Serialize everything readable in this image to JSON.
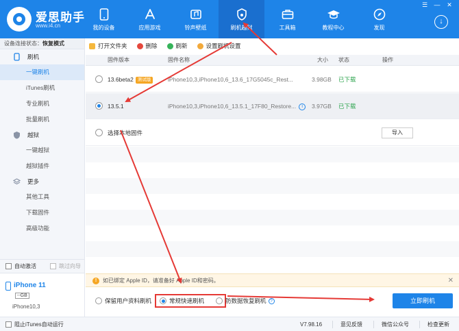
{
  "header": {
    "brand": "爱思助手",
    "url": "www.i4.cn",
    "nav": [
      {
        "label": "我的设备",
        "icon": "phone-icon"
      },
      {
        "label": "应用游戏",
        "icon": "app-store-icon"
      },
      {
        "label": "铃声壁纸",
        "icon": "ringtone-wallpaper-icon"
      },
      {
        "label": "刷机越狱",
        "icon": "shield-flash-icon",
        "active": true
      },
      {
        "label": "工具箱",
        "icon": "toolbox-icon"
      },
      {
        "label": "教程中心",
        "icon": "graduation-cap-icon"
      },
      {
        "label": "发现",
        "icon": "compass-icon"
      }
    ],
    "window": [
      "☰",
      "—",
      "✕"
    ],
    "accent": "#1e84e8"
  },
  "sidebar": {
    "status_label": "设备连接状态：",
    "status_value": "恢复模式",
    "groups": [
      {
        "label": "刷机",
        "icon": "flash-phone-icon",
        "items": [
          "一键刷机",
          "iTunes刷机",
          "专业刷机",
          "批量刷机"
        ]
      },
      {
        "label": "越狱",
        "icon": "jailbreak-icon",
        "items": [
          "一键越狱",
          "越狱插件"
        ]
      },
      {
        "label": "更多",
        "icon": "more-icon",
        "items": [
          "其他工具",
          "下载固件",
          "高级功能"
        ]
      }
    ],
    "active_item": "一键刷机",
    "auto_activate": "自动激活",
    "skip_guide": "跳过向导",
    "device": {
      "name": "iPhone 11",
      "capacity": "--GB",
      "model": "iPhone10,3"
    }
  },
  "toolbar": {
    "open_folder": "打开文件夹",
    "delete": "删除",
    "refresh": "刷新",
    "settings": "设置刷机设置"
  },
  "table": {
    "headers": [
      "固件版本",
      "固件名称",
      "大小",
      "状态",
      "操作"
    ],
    "rows": [
      {
        "version": "13.6beta2",
        "badge": "测试版",
        "name": "iPhone10,3,iPhone10,6_13.6_17G5045c_Rest...",
        "size": "3.98GB",
        "status": "已下载",
        "selected": false
      },
      {
        "version": "13.5.1",
        "name": "iPhone10,3,iPhone10,6_13.5.1_17F80_Restore...",
        "size": "3.97GB",
        "status": "已下载",
        "selected": true
      }
    ],
    "local": "选择本地固件",
    "import": "导入"
  },
  "alert": {
    "text": "如已绑定 Apple ID，请准备好 Apple ID和密码。",
    "close": "✕"
  },
  "options": {
    "items": [
      {
        "label": "保留用户资料刷机",
        "selected": false
      },
      {
        "label": "常规快速刷机",
        "selected": true
      },
      {
        "label": "防数据恢复刷机",
        "selected": false
      }
    ],
    "flash_button": "立即刷机"
  },
  "statusbar": {
    "block_itunes": "阻止iTunes自动运行",
    "version": "V7.98.16",
    "feedback": "意见反馈",
    "wechat": "微信公众号",
    "update": "检查更新"
  }
}
